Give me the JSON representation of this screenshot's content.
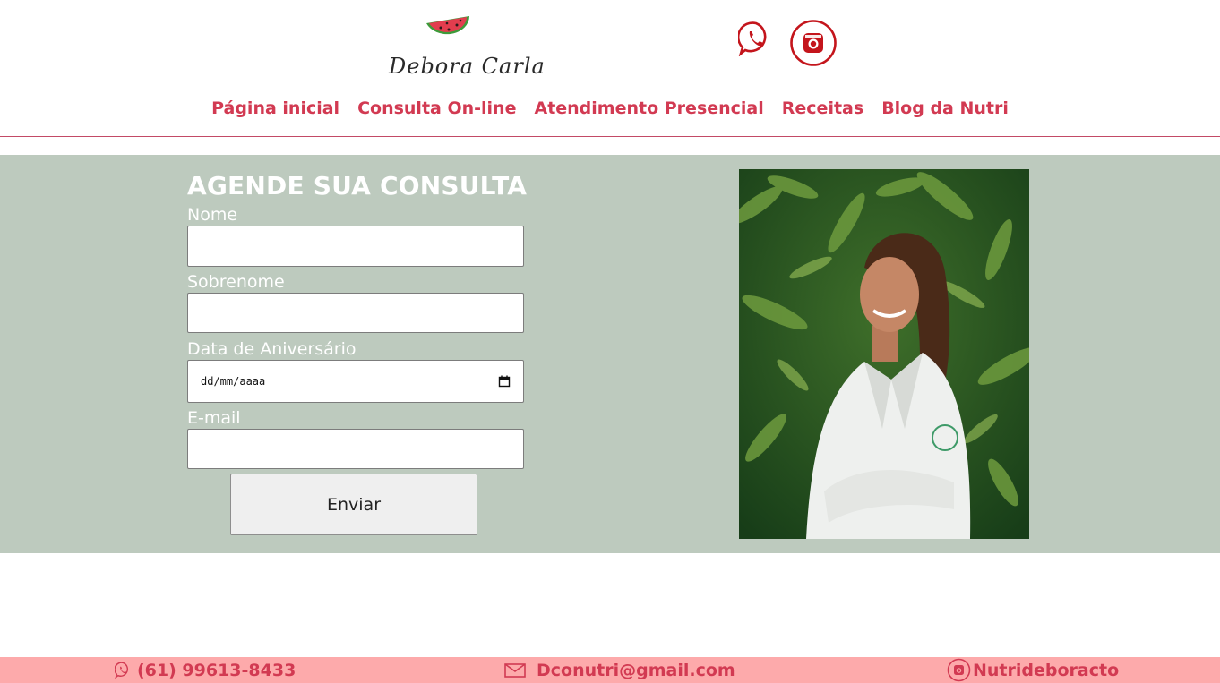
{
  "header": {
    "logo_text": "Debora Carla",
    "social": [
      {
        "name": "whatsapp",
        "icon": "whatsapp-icon"
      },
      {
        "name": "instagram",
        "icon": "instagram-icon"
      }
    ]
  },
  "nav": {
    "items": [
      {
        "label": "Página inicial"
      },
      {
        "label": "Consulta On-line"
      },
      {
        "label": "Atendimento Presencial"
      },
      {
        "label": "Receitas"
      },
      {
        "label": "Blog da Nutri"
      }
    ]
  },
  "form": {
    "title": "AGENDE SUA CONSULTA",
    "fields": [
      {
        "label": "Nome",
        "value": ""
      },
      {
        "label": "Sobrenome",
        "value": ""
      },
      {
        "label": "Data de Aniversário",
        "value": "dd/mm/aaaa"
      },
      {
        "label": "E-mail",
        "value": ""
      }
    ],
    "submit_label": "Enviar"
  },
  "footer": {
    "phone": "(61) 99613-8433",
    "email": "Dconutri@gmail.com",
    "instagram": "Nutrideboracto"
  },
  "colors": {
    "brand_pink": "#d23a52",
    "panel_green": "#bdcabe",
    "footer_pink": "#fdaaab",
    "icon_red": "#c4151c"
  }
}
